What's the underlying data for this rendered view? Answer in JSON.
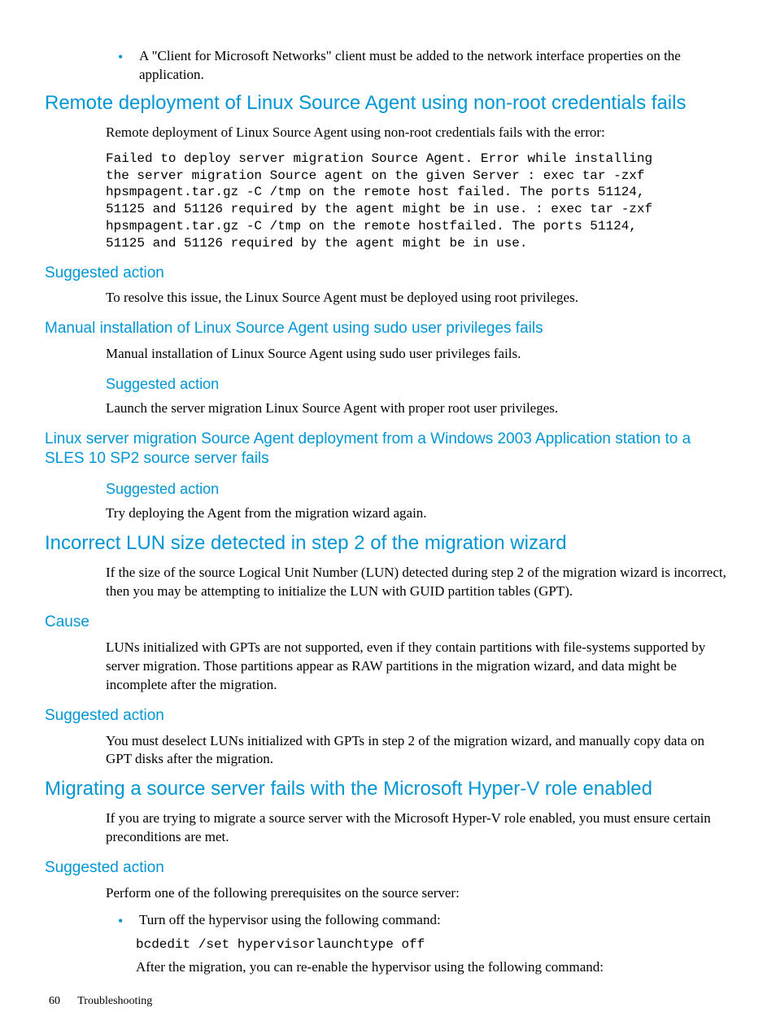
{
  "intro_bullet": "A \"Client for Microsoft Networks\" client must be added to the network interface properties on the application.",
  "sections": {
    "remote": {
      "title": "Remote deployment of Linux Source Agent using non-root credentials fails",
      "intro": "Remote deployment of Linux Source Agent using non-root credentials fails with the error:",
      "code": "Failed to deploy server migration Source Agent. Error while installing\nthe server migration Source agent on the given Server : exec tar -zxf\nhpsmpagent.tar.gz -C /tmp on the remote host failed. The ports 51124,\n51125 and 51126 required by the agent might be in use. : exec tar -zxf\nhpsmpagent.tar.gz -C /tmp on the remote hostfailed. The ports 51124,\n51125 and 51126 required by the agent might be in use.",
      "suggested_label": "Suggested action",
      "suggested_body": "To resolve this issue, the Linux Source Agent must be deployed using root privileges."
    },
    "manual": {
      "title": "Manual installation of Linux Source Agent using sudo user privileges fails",
      "intro": "Manual installation of Linux Source Agent using sudo user privileges fails.",
      "suggested_label": "Suggested action",
      "suggested_body": "Launch the server migration Linux Source Agent with proper root user privileges."
    },
    "sles": {
      "title": "Linux server migration Source Agent deployment from a Windows 2003 Application station to a SLES 10 SP2 source server fails",
      "suggested_label": "Suggested action",
      "suggested_body": "Try deploying the Agent from the migration wizard again."
    },
    "lun": {
      "title": "Incorrect LUN size detected in step 2 of the migration wizard",
      "intro": "If the size of the source Logical Unit Number (LUN) detected during step 2 of the migration wizard is incorrect, then you may be attempting to initialize the LUN with GUID partition tables (GPT).",
      "cause_label": "Cause",
      "cause_body": "LUNs initialized with GPTs are not supported, even if they contain partitions with file-systems supported by server migration. Those partitions appear as RAW partitions in the migration wizard, and data might be incomplete after the migration.",
      "suggested_label": "Suggested action",
      "suggested_body": "You must deselect LUNs initialized with GPTs in step 2 of the migration wizard, and manually copy data on GPT disks after the migration."
    },
    "hyperv": {
      "title": "Migrating a source server fails with the Microsoft Hyper-V role enabled",
      "intro": "If you are trying to migrate a source server with the Microsoft Hyper-V role enabled, you must ensure certain preconditions are met.",
      "suggested_label": "Suggested action",
      "suggested_body": "Perform one of the following prerequisites on the source server:",
      "bullet1": "Turn off the hypervisor using the following command:",
      "cmd": "bcdedit /set hypervisorlaunchtype off",
      "after": "After the migration, you can re-enable the hypervisor using the following command:"
    }
  },
  "footer": {
    "page": "60",
    "section": "Troubleshooting"
  }
}
